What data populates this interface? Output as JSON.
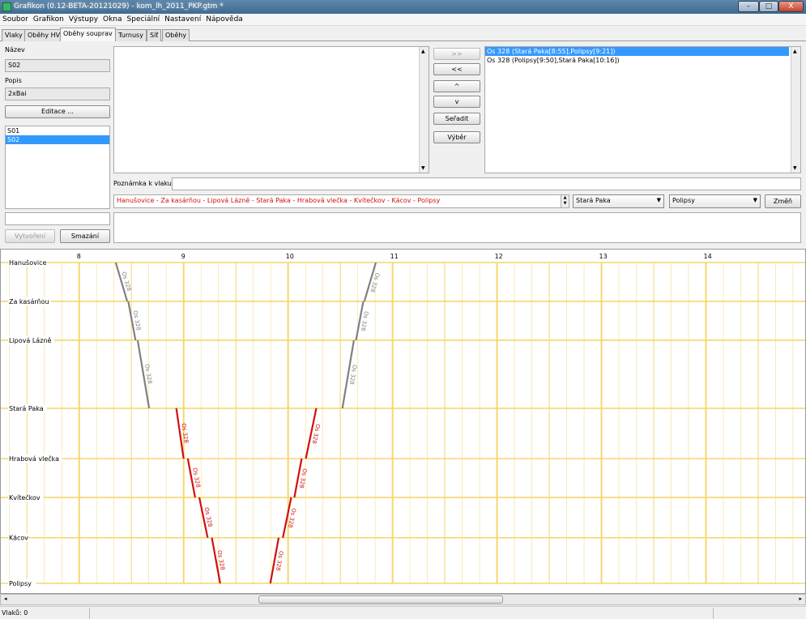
{
  "window": {
    "title": "Grafikon (0.12-BETA-20121029) - kom_lh_2011_PKP.gtm *",
    "min_label": "–",
    "max_label": "□",
    "close_label": "X"
  },
  "menu": [
    "Soubor",
    "Grafikon",
    "Výstupy",
    "Okna",
    "Speciální",
    "Nastavení",
    "Nápověda"
  ],
  "tabs": [
    "Vlaky",
    "Oběhy HV",
    "Oběhy souprav",
    "Turnusy",
    "Síť",
    "Oběhy"
  ],
  "active_tab": 2,
  "left_panel": {
    "name_label": "Název",
    "name_value": "S02",
    "desc_label": "Popis",
    "desc_value": "2xBai",
    "edit_button": "Editace ...",
    "circulations": [
      "S01",
      "S02"
    ],
    "selected_circulation": 1,
    "new_name_value": "",
    "create_button": "Vytvoření",
    "delete_button": "Smazání"
  },
  "middle_buttons": {
    "add": ">>",
    "remove": "<<",
    "up": "^",
    "down": "v",
    "sort": "Seřadit",
    "select": "Výběr"
  },
  "right_list": {
    "items": [
      "Os 328 (Stará Paka[8:55],Polipsy[9:21])",
      "Os 328 (Polipsy[9:50],Stará Paka[10:16])"
    ],
    "selected": 0
  },
  "train_note": {
    "label": "Poznámka k vlaku:",
    "value": ""
  },
  "route": {
    "text": "Hanušovice - Za kasárňou - Lipová Lázně - Stará Paka - Hrabová vlečka - Kvítečkov - Kácov - Polipsy",
    "from": "Stará Paka",
    "to": "Polipsy",
    "change_button": "Změň"
  },
  "chart_data": {
    "type": "line",
    "hours": [
      8,
      9,
      10,
      11,
      12,
      13,
      14
    ],
    "start_hour": 7.25,
    "end_hour": 14.95,
    "stations": [
      "Hanušovice",
      "Za kasárňou",
      "Lipová Lázně",
      "Stará Paka",
      "Hrabová vlečka",
      "Kvítečkov",
      "Kácov",
      "Polipsy"
    ],
    "station_positions": [
      0,
      0.109,
      0.218,
      0.409,
      0.55,
      0.659,
      0.772,
      0.9
    ],
    "grid_color": "#f5d76e",
    "train_label": "Os 328",
    "segments": [
      {
        "color": "#808080",
        "t1": 8.35,
        "s1": 0,
        "t2": 8.46,
        "s2": 1
      },
      {
        "color": "#808080",
        "t1": 8.47,
        "s1": 1,
        "t2": 8.54,
        "s2": 2
      },
      {
        "color": "#808080",
        "t1": 8.56,
        "s1": 2,
        "t2": 8.67,
        "s2": 3
      },
      {
        "color": "#d01010",
        "t1": 8.93,
        "s1": 3,
        "t2": 9.0,
        "s2": 4
      },
      {
        "color": "#d01010",
        "t1": 9.04,
        "s1": 4,
        "t2": 9.11,
        "s2": 5
      },
      {
        "color": "#d01010",
        "t1": 9.15,
        "s1": 5,
        "t2": 9.23,
        "s2": 6
      },
      {
        "color": "#d01010",
        "t1": 9.27,
        "s1": 6,
        "t2": 9.35,
        "s2": 7
      },
      {
        "color": "#d01010",
        "t1": 9.83,
        "s1": 7,
        "t2": 9.91,
        "s2": 6
      },
      {
        "color": "#d01010",
        "t1": 9.95,
        "s1": 6,
        "t2": 10.03,
        "s2": 5
      },
      {
        "color": "#d01010",
        "t1": 10.06,
        "s1": 5,
        "t2": 10.13,
        "s2": 4
      },
      {
        "color": "#d01010",
        "t1": 10.17,
        "s1": 4,
        "t2": 10.27,
        "s2": 3
      },
      {
        "color": "#808080",
        "t1": 10.52,
        "s1": 3,
        "t2": 10.63,
        "s2": 2
      },
      {
        "color": "#808080",
        "t1": 10.65,
        "s1": 2,
        "t2": 10.72,
        "s2": 1
      },
      {
        "color": "#808080",
        "t1": 10.73,
        "s1": 1,
        "t2": 10.84,
        "s2": 0
      }
    ]
  },
  "status": {
    "trains_count": "Vlaků: 0"
  }
}
